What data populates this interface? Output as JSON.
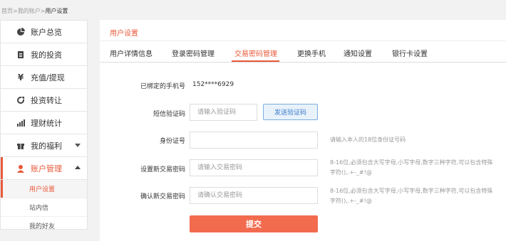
{
  "breadcrumb": {
    "home": "首页",
    "sep1": ">",
    "account": "我的账户",
    "sep2": ">",
    "current": "用户设置"
  },
  "sidebar": {
    "items": [
      {
        "label": "账户总览",
        "icon": "pie-chart-icon"
      },
      {
        "label": "我的投资",
        "icon": "document-icon"
      },
      {
        "label": "充值/提现",
        "icon": "yen-icon"
      },
      {
        "label": "投资转让",
        "icon": "refresh-icon"
      },
      {
        "label": "理财统计",
        "icon": "bar-chart-icon"
      },
      {
        "label": "我的福利",
        "icon": "gift-icon"
      },
      {
        "label": "账户管理",
        "icon": "user-icon"
      }
    ],
    "subitems": [
      {
        "label": "用户设置"
      },
      {
        "label": "站内信"
      },
      {
        "label": "我的好友"
      }
    ]
  },
  "main": {
    "title": "用户设置",
    "tabs": [
      {
        "label": "用户详情信息"
      },
      {
        "label": "登录密码管理"
      },
      {
        "label": "交易密码管理"
      },
      {
        "label": "更换手机"
      },
      {
        "label": "通知设置"
      },
      {
        "label": "银行卡设置"
      }
    ],
    "active_tab": "交易密码管理"
  },
  "form": {
    "phone_label": "已绑定的手机号",
    "phone_value": "152****6929",
    "sms_label": "短信验证码",
    "sms_placeholder": "请输入验证码",
    "send_code_label": "发送验证码",
    "id_label": "身份证号",
    "id_placeholder": "",
    "id_hint": "请输入本人的18位身份证号码",
    "new_pwd_label": "设置新交易密码",
    "new_pwd_placeholder": "请输入交易密码",
    "new_pwd_hint": "8-16位,必须包含大写字母,小写字母,数字三种字符,可以包含特殊字符(),.+-_#!@",
    "confirm_pwd_label": "确认新交易密码",
    "confirm_pwd_placeholder": "请确认交易密码",
    "confirm_pwd_hint": "8-16位,必须包含大写字母,小写字母,数字三种字符,可以包含特殊字符(),.+-_#!@",
    "submit_label": "提交"
  },
  "colors": {
    "accent": "#e8593a",
    "button": "#f26b4f",
    "link_blue": "#3a7cc7"
  }
}
